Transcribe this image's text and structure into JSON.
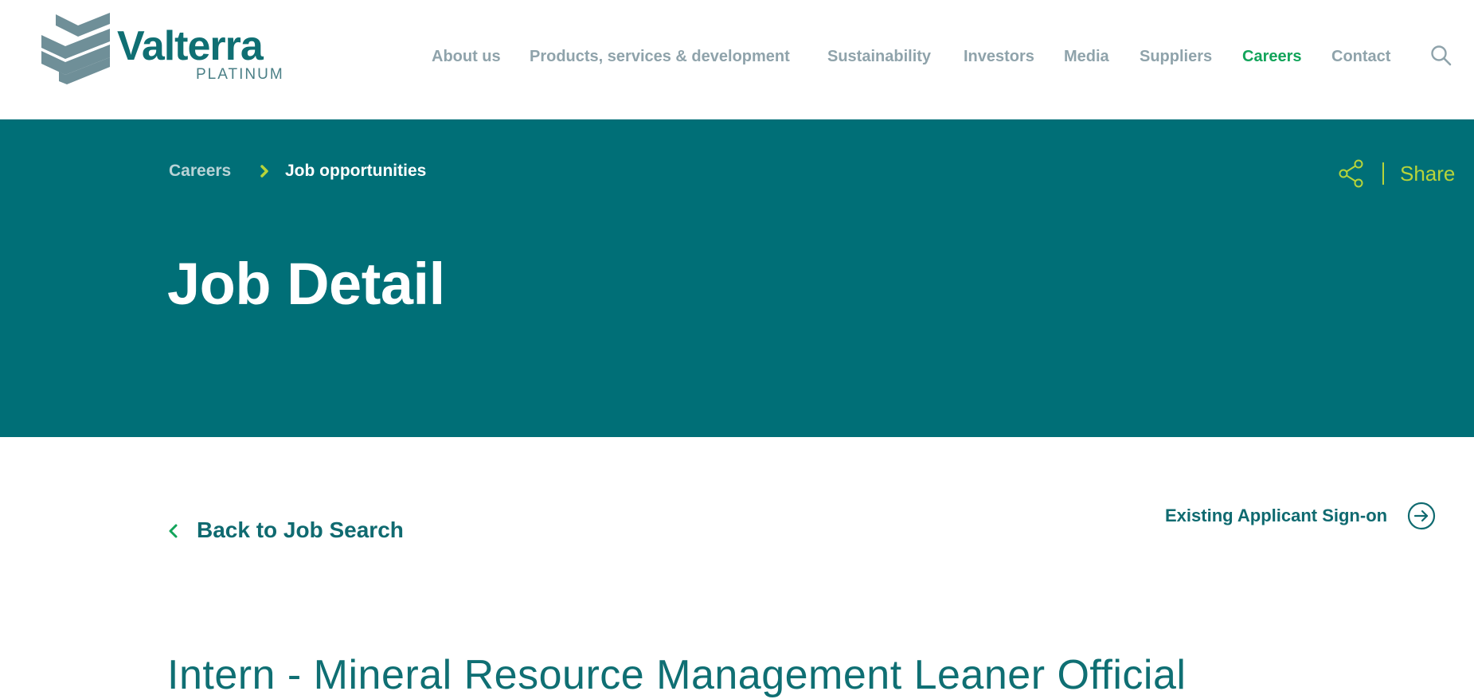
{
  "brand": {
    "name": "Valterra",
    "sub": "PLATINUM",
    "color": "#0f6f73"
  },
  "nav": {
    "items": [
      {
        "label": "About us",
        "active": false
      },
      {
        "label": "Products, services & development",
        "active": false
      },
      {
        "label": "Sustainability",
        "active": false
      },
      {
        "label": "Investors",
        "active": false
      },
      {
        "label": "Media",
        "active": false
      },
      {
        "label": "Suppliers",
        "active": false
      },
      {
        "label": "Careers",
        "active": true
      },
      {
        "label": "Contact",
        "active": false
      }
    ],
    "search_icon": "search-icon"
  },
  "hero": {
    "breadcrumb": {
      "parent": "Careers",
      "current": "Job opportunities"
    },
    "share_label": "Share",
    "title": "Job Detail",
    "background": "#006f77",
    "accent": "#b7d43a"
  },
  "main": {
    "back_label": "Back to Job Search",
    "signon_label": "Existing Applicant Sign-on",
    "job_title": "Intern - Mineral Resource Management Leaner Official"
  }
}
